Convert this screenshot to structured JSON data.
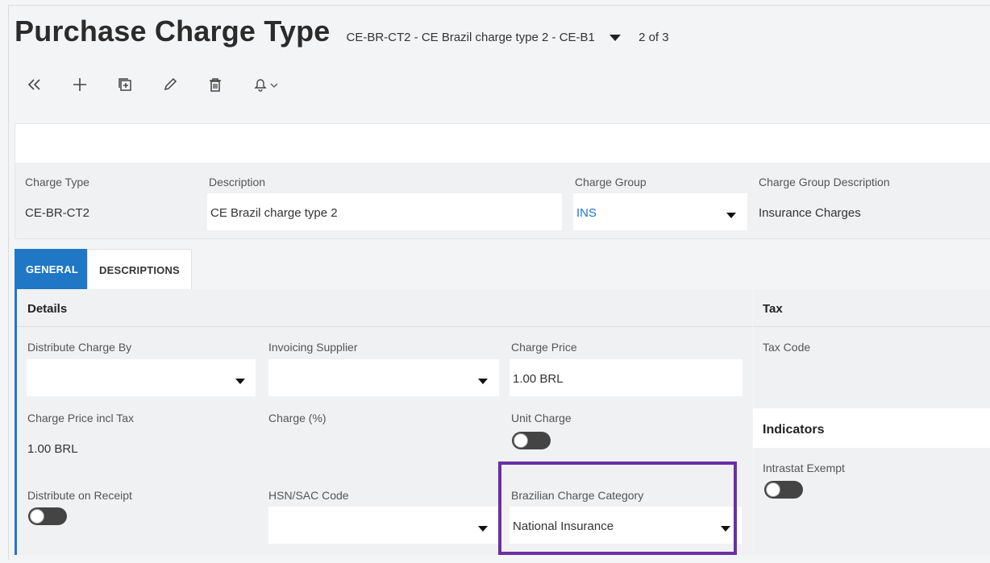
{
  "header": {
    "title": "Purchase Charge Type",
    "record_selector": "CE-BR-CT2 - CE Brazil charge type 2 - CE-B1",
    "record_count": "2 of 3"
  },
  "toolbar": {
    "icons": [
      "collapse-icon",
      "add-icon",
      "duplicate-icon",
      "edit-icon",
      "delete-icon",
      "notification-bell-icon"
    ]
  },
  "record": {
    "charge_type_label": "Charge Type",
    "charge_type_value": "CE-BR-CT2",
    "description_label": "Description",
    "description_value": "CE Brazil charge type 2",
    "charge_group_label": "Charge Group",
    "charge_group_value": "INS",
    "charge_group_desc_label": "Charge Group Description",
    "charge_group_desc_value": "Insurance Charges"
  },
  "tabs": [
    {
      "label": "GENERAL",
      "active": true
    },
    {
      "label": "DESCRIPTIONS",
      "active": false
    }
  ],
  "details": {
    "title": "Details",
    "distribute_charge_by_label": "Distribute Charge By",
    "distribute_charge_by_value": "",
    "invoicing_supplier_label": "Invoicing Supplier",
    "invoicing_supplier_value": "",
    "charge_price_label": "Charge Price",
    "charge_price_value": "1.00 BRL",
    "charge_price_incl_tax_label": "Charge Price incl Tax",
    "charge_price_incl_tax_value": "1.00 BRL",
    "charge_pct_label": "Charge (%)",
    "unit_charge_label": "Unit Charge",
    "unit_charge_on": false,
    "distribute_on_receipt_label": "Distribute on Receipt",
    "distribute_on_receipt_on": false,
    "hsn_sac_label": "HSN/SAC Code",
    "hsn_sac_value": "",
    "brazilian_category_label": "Brazilian Charge Category",
    "brazilian_category_value": "National Insurance"
  },
  "tax": {
    "title": "Tax",
    "tax_code_label": "Tax Code"
  },
  "indicators": {
    "title": "Indicators",
    "intrastat_exempt_label": "Intrastat Exempt",
    "intrastat_exempt_on": false
  },
  "colors": {
    "accent": "#1f77c6",
    "highlight": "#6a2fa6"
  }
}
